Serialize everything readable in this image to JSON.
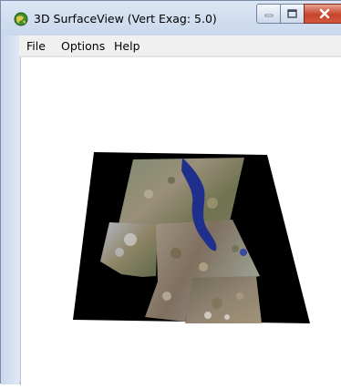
{
  "window": {
    "title": "3D SurfaceView (Vert Exag: 5.0)",
    "icon": "globe-app-icon"
  },
  "titlebar_buttons": {
    "minimize_icon": "minimize-icon",
    "maximize_icon": "maximize-icon",
    "close_icon": "close-icon",
    "close_color": "#c8452c"
  },
  "menu": {
    "items": [
      {
        "label": "File"
      },
      {
        "label": "Options"
      },
      {
        "label": "Help"
      }
    ]
  },
  "viewport": {
    "background": "#ffffff",
    "content": "3d-terrain-surface"
  }
}
